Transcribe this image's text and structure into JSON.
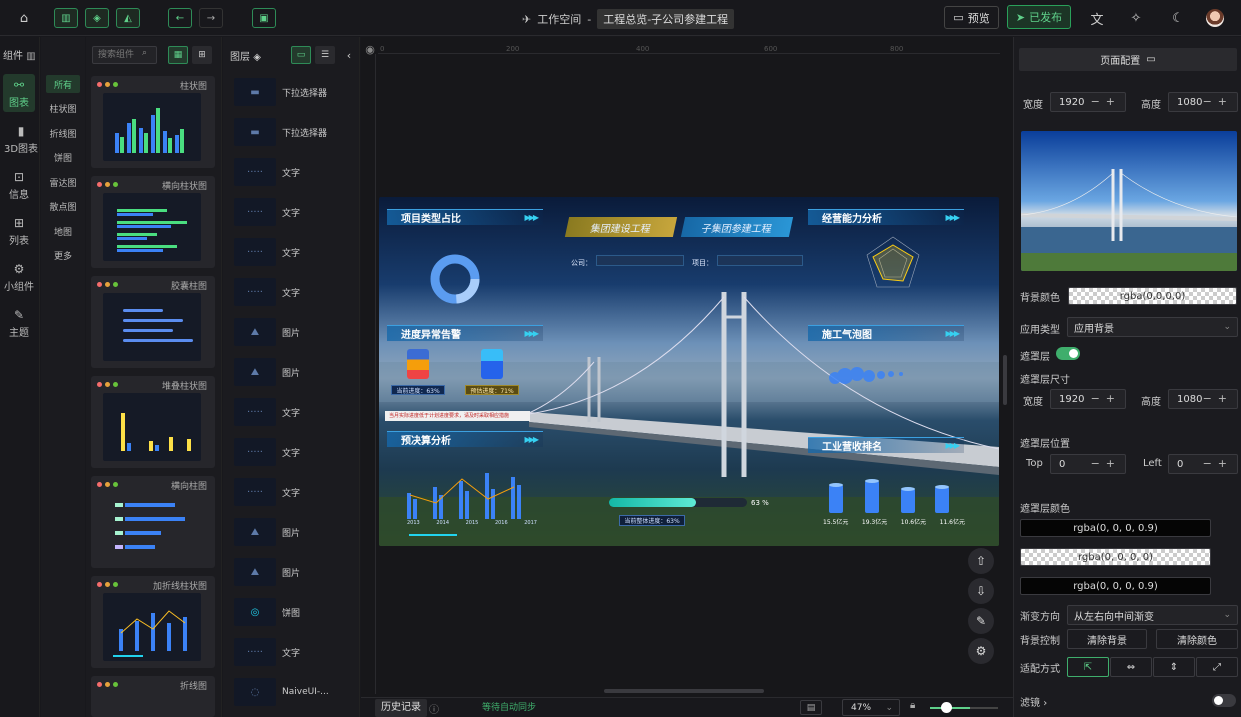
{
  "topbar": {
    "workspace": "工作空间",
    "separator": "-",
    "project_title": "工程总览-子公司参建工程",
    "preview_label": "预览",
    "publish_label": "已发布"
  },
  "left_rail": {
    "header": "组件",
    "items": [
      {
        "label": "图表",
        "icon": "chart-icon"
      },
      {
        "label": "3D图表",
        "icon": "bar-3d-icon"
      },
      {
        "label": "信息",
        "icon": "info-icon"
      },
      {
        "label": "列表",
        "icon": "list-icon"
      },
      {
        "label": "小组件",
        "icon": "widget-icon"
      },
      {
        "label": "主题",
        "icon": "theme-icon"
      }
    ]
  },
  "categories": [
    "所有",
    "柱状图",
    "折线图",
    "饼图",
    "雷达图",
    "散点图",
    "地图",
    "更多"
  ],
  "search": {
    "placeholder": "搜索组件"
  },
  "cards": [
    "柱状图",
    "横向柱状图",
    "胶囊柱图",
    "堆叠柱状图",
    "横向柱图",
    "加折线柱状图",
    "折线图"
  ],
  "layers": {
    "header": "图层",
    "items": [
      "下拉选择器",
      "下拉选择器",
      "文字",
      "文字",
      "文字",
      "文字",
      "图片",
      "图片",
      "文字",
      "文字",
      "文字",
      "图片",
      "图片",
      "饼图",
      "文字",
      "NaiveUI-..."
    ]
  },
  "stage": {
    "chip_left": "集团建设工程",
    "chip_right": "子集团参建工程",
    "company_label": "公司：",
    "project_label": "项目：",
    "sections": [
      "项目类型占比",
      "进度异常告警",
      "预决算分析",
      "经营能力分析",
      "施工气泡图",
      "工业营收排名"
    ],
    "progress_value": "63 %",
    "progress_fraction": 0.63,
    "progress_caption": "当前整体进度：63%",
    "alarm_left": "当前进度：63%",
    "alarm_right": "预估进度：71%",
    "alert_text": "当月实际进度低于计划进度要求，请及时采取相应措施",
    "bar_years": [
      "2013",
      "2014",
      "2015",
      "2016",
      "2017"
    ],
    "revenue_values": [
      "15.5亿元",
      "19.3亿元",
      "10.6亿元",
      "11.6亿元"
    ]
  },
  "bottombar": {
    "history": "历史记录",
    "sync": "等待自动同步",
    "zoom": "47%"
  },
  "right_panel": {
    "tab": "页面配置",
    "width_label": "宽度",
    "width_value": "1920",
    "height_label": "高度",
    "height_value": "1080",
    "bg_color_label": "背景颜色",
    "bg_color_value": "rgba(0,0,0,0)",
    "app_type_label": "应用类型",
    "app_type_value": "应用背景",
    "mask_label": "遮罩层",
    "mask_size_label": "遮罩层尺寸",
    "mask_width_label": "宽度",
    "mask_width_value": "1920",
    "mask_height_label": "高度",
    "mask_height_value": "1080",
    "mask_pos_label": "遮罩层位置",
    "top_label": "Top",
    "top_value": "0",
    "left_label": "Left",
    "left_value": "0",
    "mask_color_label": "遮罩层颜色",
    "mask_colors": [
      "rgba(0, 0, 0, 0.9)",
      "rgba(0, 0, 0, 0)",
      "rgba(0, 0, 0, 0.9)"
    ],
    "gradient_label": "渐变方向",
    "gradient_value": "从左右向中间渐变",
    "bg_ctrl_label": "背景控制",
    "clear_bg": "清除背景",
    "clear_color": "清除颜色",
    "fit_label": "适配方式",
    "filter_label": "滤镜"
  },
  "colors": {
    "accent": "#5fd08a",
    "panel": "#1b1b1f",
    "bg": "#18181c"
  }
}
